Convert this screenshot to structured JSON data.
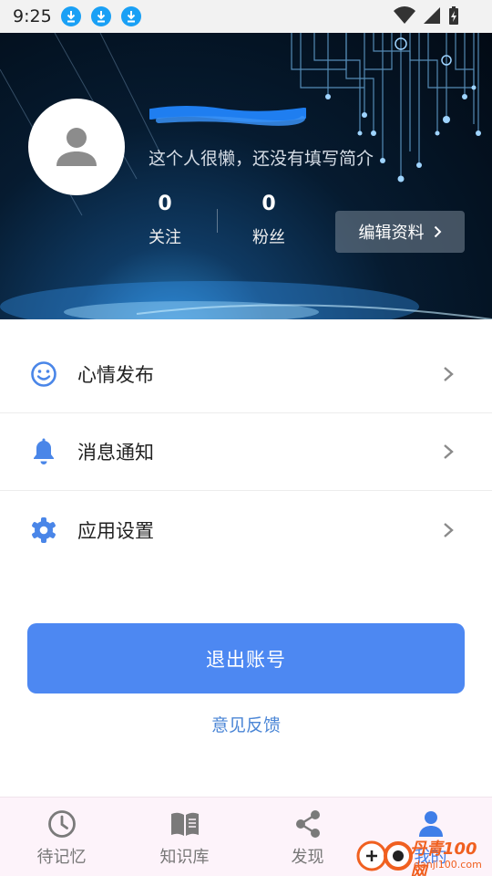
{
  "status_bar": {
    "time": "9:25",
    "notification_icons": [
      "download-icon",
      "download-icon",
      "download-icon"
    ],
    "right_icons": [
      "wifi-icon",
      "cell-signal-icon",
      "battery-charging-icon"
    ]
  },
  "profile": {
    "username": "",
    "username_redacted": true,
    "bio": "这个人很懒，还没有填写简介",
    "following_count": "0",
    "following_label": "关注",
    "followers_count": "0",
    "followers_label": "粉丝",
    "edit_button_label": "编辑资料"
  },
  "menu": {
    "items": [
      {
        "label": "心情发布",
        "icon": "smiley-icon"
      },
      {
        "label": "消息通知",
        "icon": "bell-icon"
      },
      {
        "label": "应用设置",
        "icon": "gear-icon"
      }
    ]
  },
  "actions": {
    "logout_label": "退出账号",
    "feedback_label": "意见反馈"
  },
  "bottom_nav": {
    "items": [
      {
        "label": "待记忆",
        "icon": "clock-icon"
      },
      {
        "label": "知识库",
        "icon": "book-icon"
      },
      {
        "label": "发现",
        "icon": "share-icon"
      },
      {
        "label": "我的",
        "icon": "person-icon",
        "active": true
      }
    ]
  },
  "watermark": {
    "title": "丹青100网",
    "url": "danji100.com"
  },
  "colors": {
    "accent": "#4d88f2",
    "link": "#4b86d6",
    "active_nav": "#3f7ee8",
    "menu_icon": "#4a86e8",
    "status_download": "#1aa0f5"
  }
}
